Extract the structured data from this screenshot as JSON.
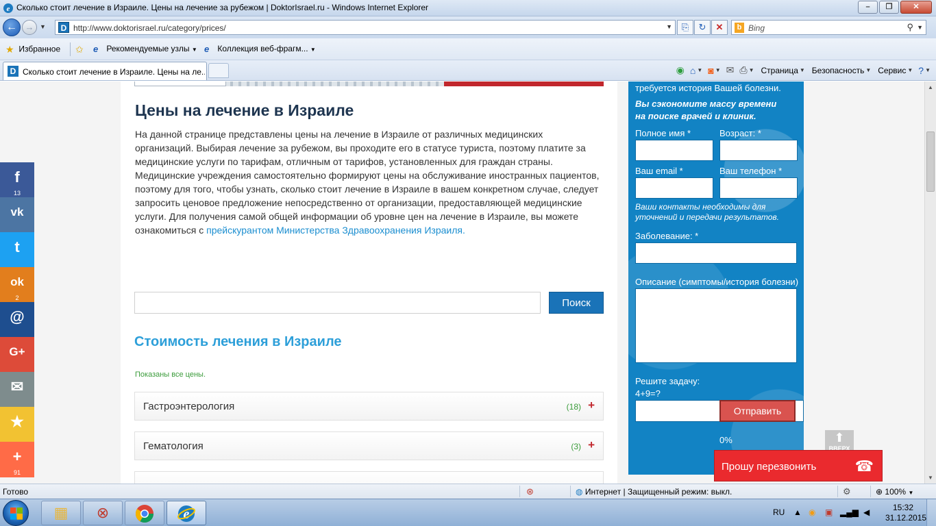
{
  "window": {
    "title": "Сколько стоит лечение в Израиле. Цены на лечение за рубежом | DoktorIsrael.ru - Windows Internet Explorer"
  },
  "address": {
    "url": "http://www.doktorisrael.ru/category/prices/",
    "search_placeholder": "Bing"
  },
  "favorites": {
    "favorites_label": "Избранное",
    "suggested_sites": "Рекомендуемые узлы",
    "web_slice_gallery": "Коллекция веб-фрагм..."
  },
  "tab": {
    "title": "Сколько стоит лечение в Израиле. Цены на ле..."
  },
  "commandbar": {
    "page": "Страница",
    "safety": "Безопасность",
    "tools": "Сервис"
  },
  "page": {
    "h1": "Цены на лечение в Израиле",
    "intro_text": "На данной странице представлены цены на лечение в Израиле от различных медицинских организаций. Выбирая лечение за рубежом, вы проходите его в статусе туриста, поэтому платите за медицинские услуги по тарифам, отличным от тарифов, установленных для граждан страны. Медицинские учреждения самостоятельно формируют цены на обслуживание иностранных пациентов, поэтому для того, чтобы узнать, сколько стоит лечение в Израиле в вашем конкретном случае, следует запросить ценовое предложение непосредственно от организации, предоставляющей медицинские услуги. Для получения самой общей информации об уровне цен на лечение в Израиле, вы можете ознакомиться с ",
    "intro_link": "прейскурантом Министерства Здравоохранения Израиля.",
    "search_button": "Поиск",
    "h2": "Стоимость лечения в Израиле",
    "shown_note": "Показаны все цены.",
    "categories": [
      {
        "name": "Гастроэнтерология",
        "count": "(18)"
      },
      {
        "name": "Гематология",
        "count": "(3)"
      }
    ]
  },
  "form": {
    "top_text": "требуется история Вашей болезни.",
    "promo_line1": "Вы сэкономите массу времени",
    "promo_line2": "на поиске врачей и клиник.",
    "full_name_label": "Полное имя *",
    "age_label": "Возраст: *",
    "email_label": "Ваш email *",
    "phone_label": "Ваш телефон *",
    "contacts_note_line1": "Ваши контакты необходимы для",
    "contacts_note_line2": "уточнений и передачи результатов.",
    "disease_label": "Заболевание: *",
    "description_label": "Описание (симптомы/история болезни)",
    "captcha_label": "Решите задачу:",
    "captcha_question": "4+9=?",
    "submit_label": "Отправить",
    "progress": "0%"
  },
  "widgets": {
    "up_label": "ВВЕРХ",
    "callback_label": "Прошу перезвонить"
  },
  "social": [
    {
      "name": "facebook",
      "glyph": "f",
      "count": "13",
      "color": "#3b5998"
    },
    {
      "name": "vkontakte",
      "glyph": "vk",
      "count": "",
      "color": "#4c75a3"
    },
    {
      "name": "twitter",
      "glyph": "t",
      "count": "",
      "color": "#1da1f2"
    },
    {
      "name": "odnoklassniki",
      "glyph": "ok",
      "count": "2",
      "color": "#e27e1d"
    },
    {
      "name": "mail-ru",
      "glyph": "@",
      "count": "",
      "color": "#1e4e8f"
    },
    {
      "name": "google-plus",
      "glyph": "G+",
      "count": "",
      "color": "#dd4b39"
    },
    {
      "name": "email",
      "glyph": "✉",
      "count": "",
      "color": "#7e8c8d"
    },
    {
      "name": "favorites",
      "glyph": "★",
      "count": "",
      "color": "#f2c232"
    },
    {
      "name": "more",
      "glyph": "+",
      "count": "91",
      "color": "#ff6b47"
    }
  ],
  "statusbar": {
    "ready": "Готово",
    "zone": "Интернет | Защищенный режим: выкл.",
    "zoom": "100%"
  },
  "taskbar": {
    "language": "RU",
    "time": "15:32",
    "date": "31.12.2015"
  }
}
